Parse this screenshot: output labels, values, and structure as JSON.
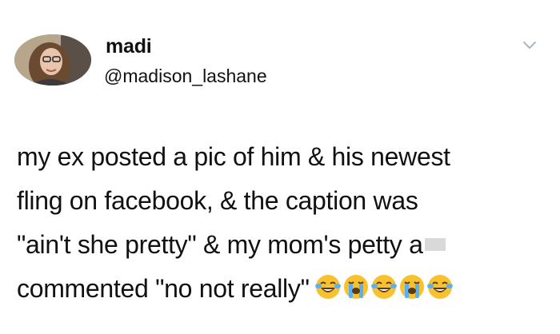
{
  "tweet": {
    "author_name": "madi",
    "author_handle": "@madison_lashane",
    "lines": [
      "my ex posted a pic of him & his newest",
      "fling on facebook, & the caption was",
      "\"ain't she pretty\" & my mom's petty a",
      "commented \"no not really\""
    ],
    "emojis": [
      "face-with-tears-of-joy",
      "loudly-crying-face",
      "face-with-tears-of-joy",
      "loudly-crying-face",
      "face-with-tears-of-joy"
    ]
  },
  "colors": {
    "text": "#111111",
    "chevron": "#aab8c2",
    "emoji_face": "#f7c12f"
  }
}
